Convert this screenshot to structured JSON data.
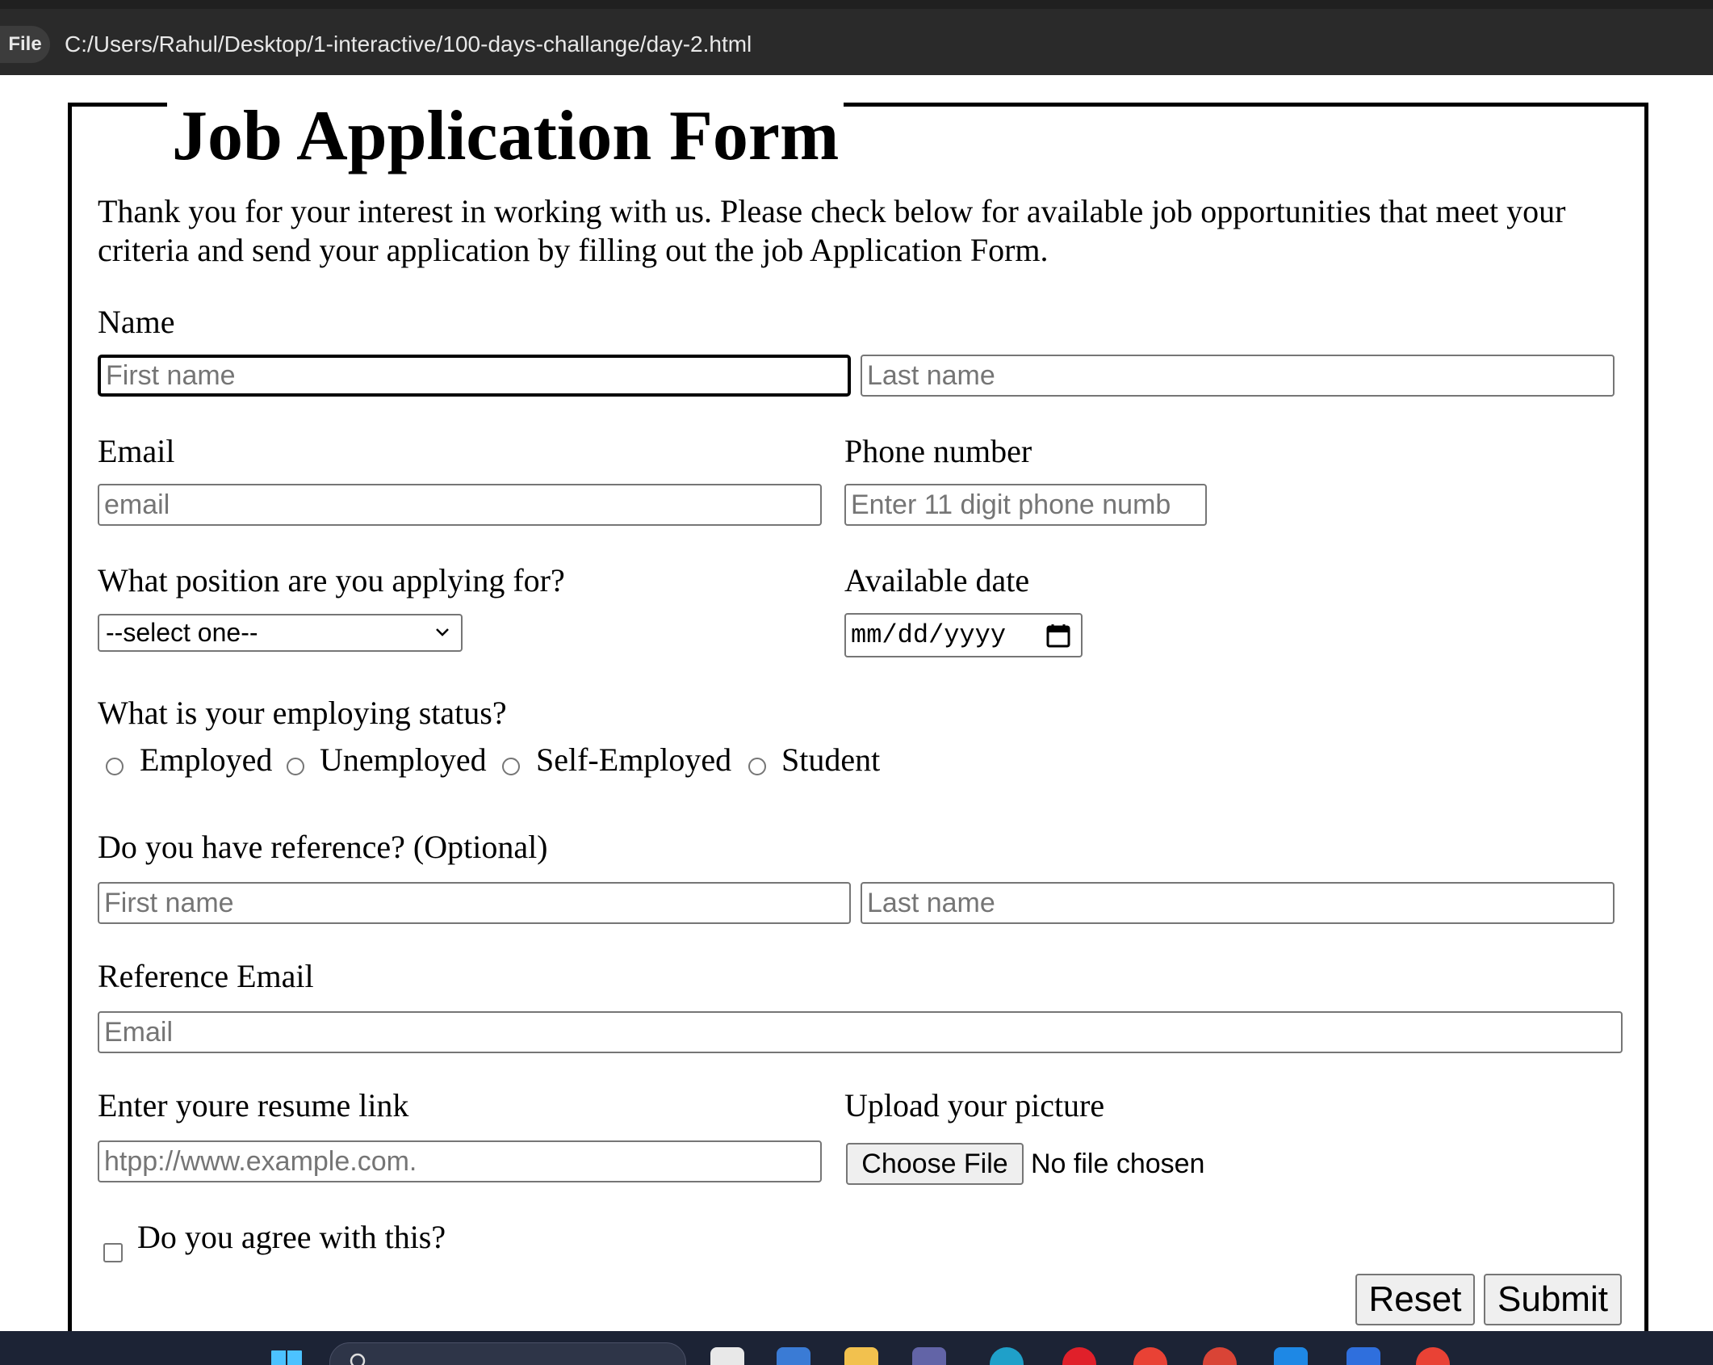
{
  "browser": {
    "file_chip": "File",
    "url": "C:/Users/Rahul/Desktop/1-interactive/100-days-challange/day-2.html"
  },
  "form": {
    "legend": "Job Application Form",
    "intro": "Thank you for your interest in working with us. Please check below for available job opportunities that meet your criteria and send your application by filling out the job Application Form.",
    "name": {
      "label": "Name",
      "first_placeholder": "First name",
      "last_placeholder": "Last name"
    },
    "email": {
      "label": "Email",
      "placeholder": "email"
    },
    "phone": {
      "label": "Phone number",
      "placeholder": "Enter 11 digit phone numb"
    },
    "position": {
      "label": "What position are you applying for?",
      "selected": "--select one--"
    },
    "available_date": {
      "label": "Available date",
      "value": "mm/dd/yyyy"
    },
    "status": {
      "label": "What is your employing status?",
      "options": [
        "Employed",
        "Unemployed",
        "Self-Employed",
        "Student"
      ]
    },
    "reference": {
      "label": "Do you have reference? (Optional)",
      "first_placeholder": "First name",
      "last_placeholder": "Last name"
    },
    "reference_email": {
      "label": "Reference Email",
      "placeholder": "Email"
    },
    "resume": {
      "label": "Enter youre resume link",
      "placeholder": "htpp://www.example.com."
    },
    "picture": {
      "label": "Upload your picture",
      "button": "Choose File",
      "status": "No file chosen"
    },
    "agree": {
      "label": "Do you agree with this?"
    },
    "buttons": {
      "reset": "Reset",
      "submit": "Submit"
    }
  },
  "taskbar": {
    "icons": [
      "windows-start-icon",
      "search-icon",
      "widgets-icon",
      "task-view-icon",
      "copilot-icon",
      "file-explorer-icon",
      "teams-icon",
      "edge-icon",
      "opera-icon",
      "chrome-icon",
      "chrome-profile-icon",
      "vscode-icon",
      "store-icon",
      "chrome-active-icon"
    ]
  }
}
